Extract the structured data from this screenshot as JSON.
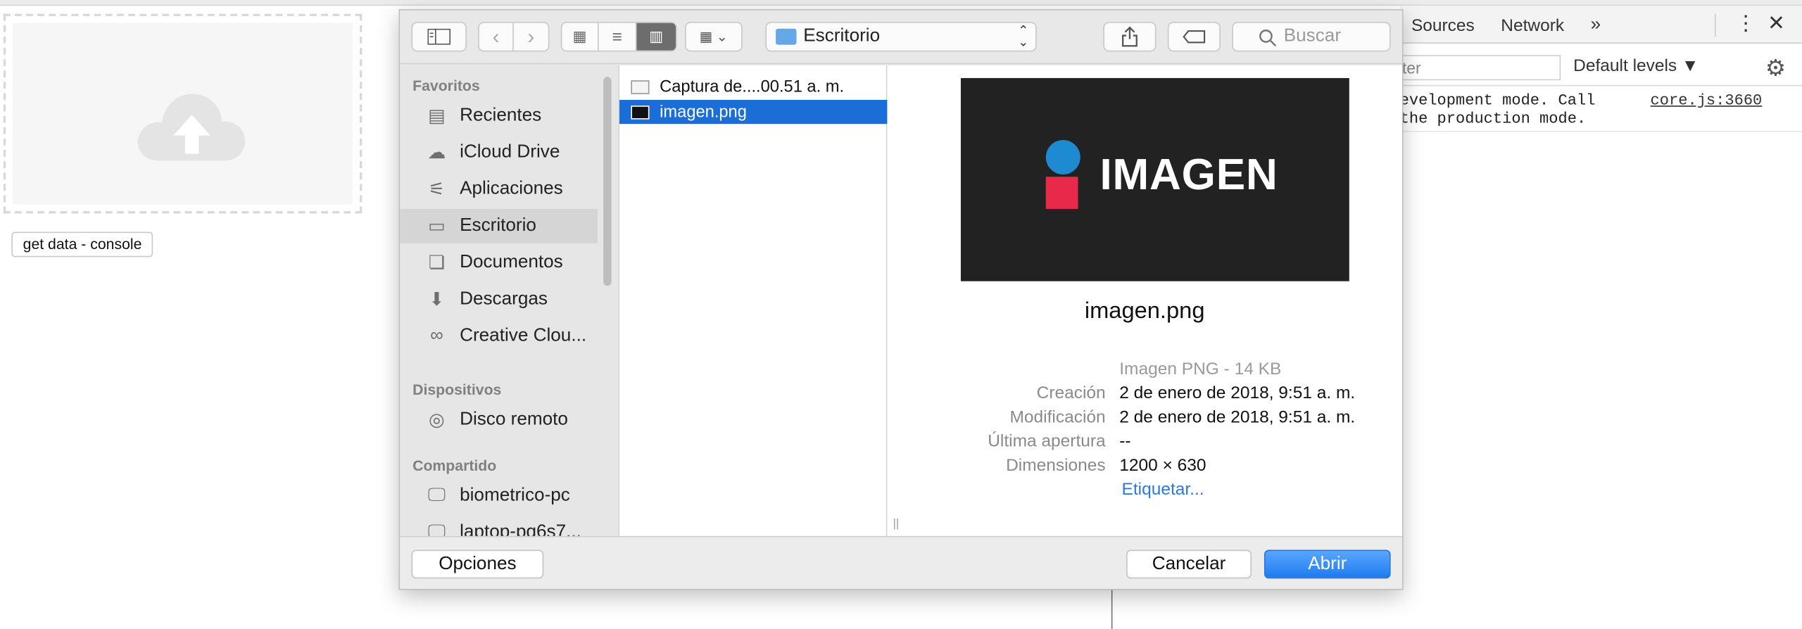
{
  "page": {
    "get_data_button": "get data - console"
  },
  "devtools": {
    "tabs": [
      "Sources",
      "Network"
    ],
    "more": "»",
    "kebab": "⋮",
    "close": "✕",
    "filter_placeholder": "ter",
    "levels": "Default levels ▼",
    "log_line1": "evelopment mode. Call",
    "log_line2": "the production mode.",
    "log_source": "core.js:3660"
  },
  "dialog": {
    "path": "Escritorio",
    "search_placeholder": "Buscar",
    "sidebar": {
      "favorites_header": "Favoritos",
      "favorites": [
        {
          "label": "Recientes",
          "icon": "recents-icon"
        },
        {
          "label": "iCloud Drive",
          "icon": "cloud-icon"
        },
        {
          "label": "Aplicaciones",
          "icon": "applications-icon"
        },
        {
          "label": "Escritorio",
          "icon": "desktop-icon",
          "selected": true
        },
        {
          "label": "Documentos",
          "icon": "documents-icon"
        },
        {
          "label": "Descargas",
          "icon": "downloads-icon"
        },
        {
          "label": "Creative Clou...",
          "icon": "creative-cloud-icon"
        }
      ],
      "devices_header": "Dispositivos",
      "devices": [
        {
          "label": "Disco remoto",
          "icon": "disc-icon"
        }
      ],
      "shared_header": "Compartido",
      "shared": [
        {
          "label": "biometrico-pc",
          "icon": "computer-icon"
        },
        {
          "label": "laptop-pq6s7...",
          "icon": "computer-icon"
        }
      ]
    },
    "files": [
      {
        "name": "Captura de....00.51 a. m.",
        "selected": false
      },
      {
        "name": "imagen.png",
        "selected": true
      }
    ],
    "preview": {
      "image_text": "IMAGEN",
      "filename": "imagen.png",
      "kind": "Imagen PNG - 14 KB",
      "created_label": "Creación",
      "created_value": "2 de enero de 2018, 9:51 a. m.",
      "modified_label": "Modificación",
      "modified_value": "2 de enero de 2018, 9:51 a. m.",
      "last_opened_label": "Última apertura",
      "last_opened_value": "--",
      "dimensions_label": "Dimensiones",
      "dimensions_value": "1200 × 630",
      "tag_link": "Etiquetar..."
    },
    "buttons": {
      "options": "Opciones",
      "cancel": "Cancelar",
      "open": "Abrir"
    }
  }
}
